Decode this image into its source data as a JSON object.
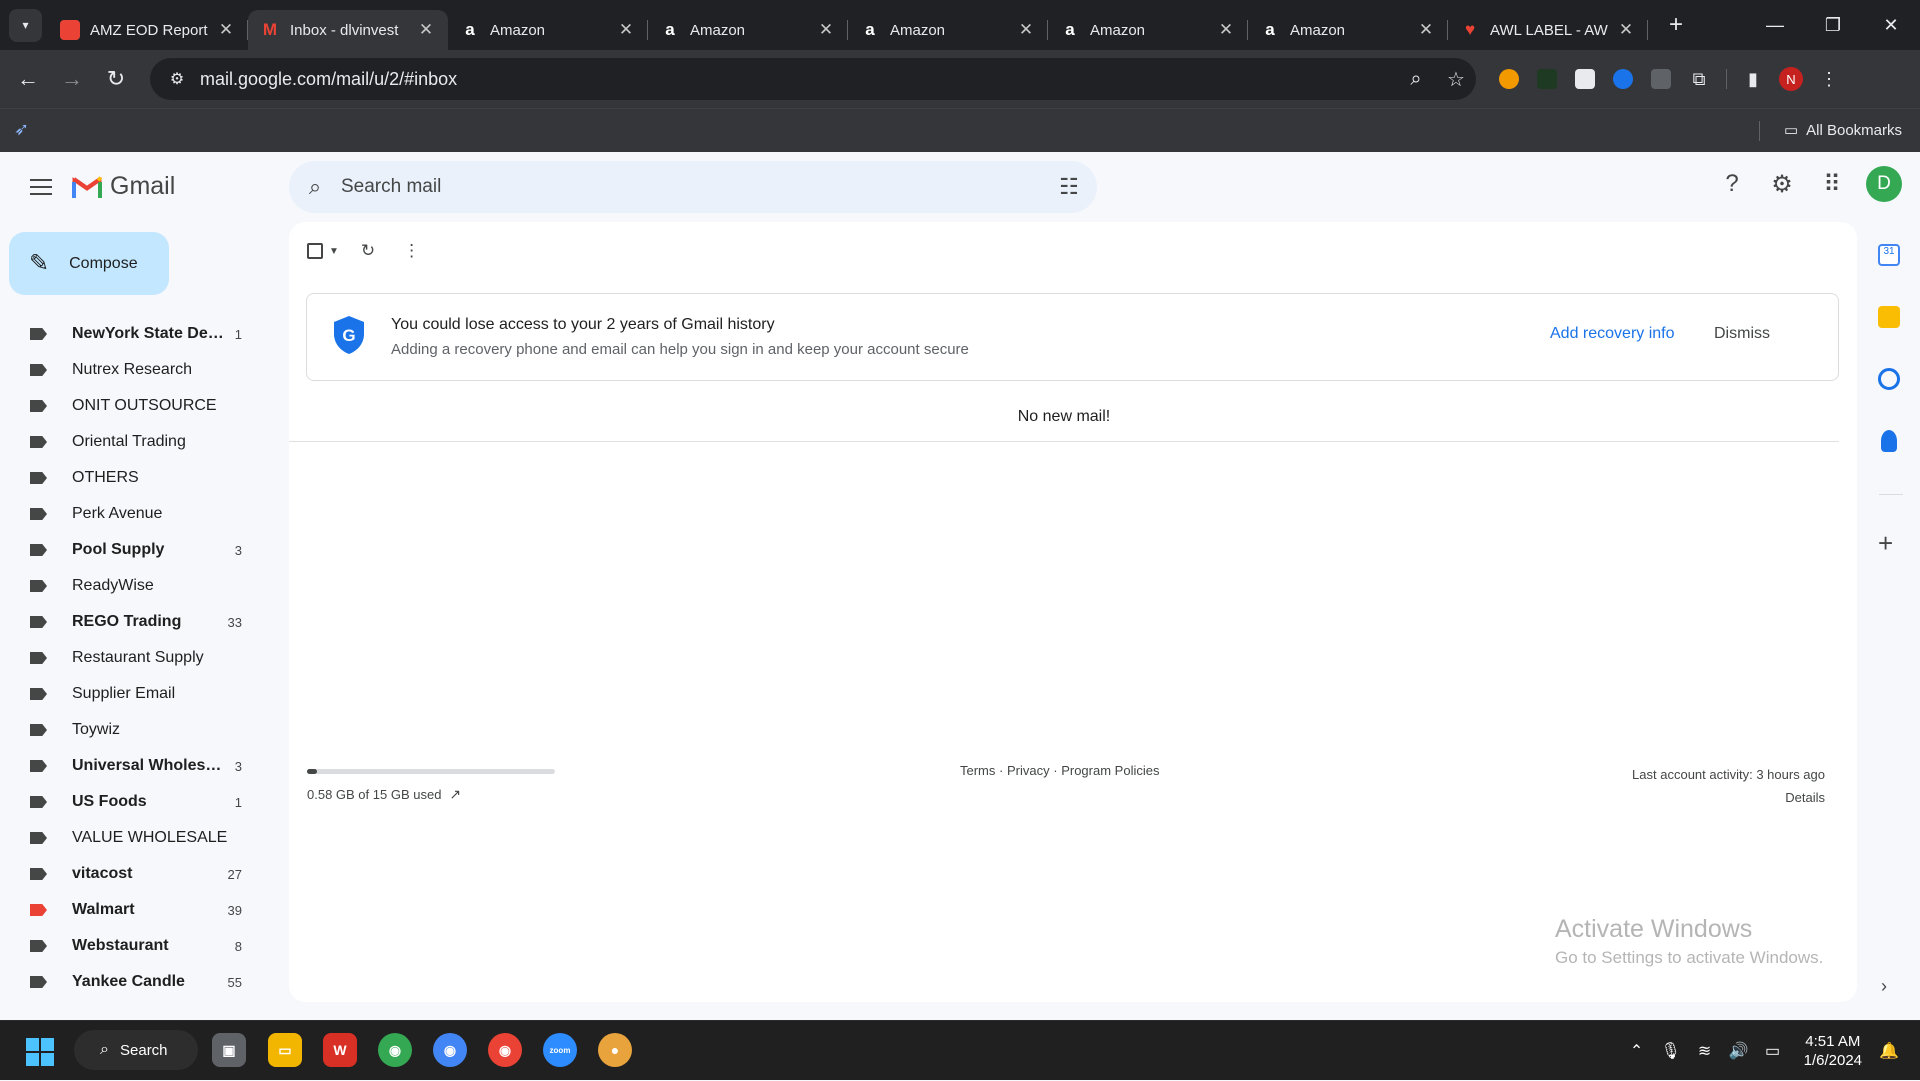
{
  "browser": {
    "tabs": [
      {
        "title": "AMZ EOD Report",
        "favicon": "red-white-app-icon",
        "active": false
      },
      {
        "title": "Inbox - dlvinvest",
        "favicon": "gmail-icon",
        "active": true
      },
      {
        "title": "Amazon",
        "favicon": "amazon-icon",
        "active": false
      },
      {
        "title": "Amazon",
        "favicon": "amazon-icon",
        "active": false
      },
      {
        "title": "Amazon",
        "favicon": "amazon-icon",
        "active": false
      },
      {
        "title": "Amazon",
        "favicon": "amazon-icon",
        "active": false
      },
      {
        "title": "Amazon",
        "favicon": "amazon-icon",
        "active": false
      },
      {
        "title": "AWL LABEL - AW",
        "favicon": "red-logo-icon",
        "active": false
      }
    ],
    "url": "mail.google.com/mail/u/2/#inbox",
    "profile_initial": "N",
    "bookmarks_label": "All Bookmarks"
  },
  "gmail": {
    "product_name": "Gmail",
    "search_placeholder": "Search mail",
    "avatar_initial": "D",
    "compose_label": "Compose",
    "labels": [
      {
        "name": "NewYork State Dep...",
        "count": "1",
        "bold": true,
        "color": "#444746"
      },
      {
        "name": "Nutrex Research",
        "count": "",
        "bold": false,
        "color": "#444746"
      },
      {
        "name": "ONIT OUTSOURCE",
        "count": "",
        "bold": false,
        "color": "#444746"
      },
      {
        "name": "Oriental Trading",
        "count": "",
        "bold": false,
        "color": "#444746"
      },
      {
        "name": "OTHERS",
        "count": "",
        "bold": false,
        "color": "#444746"
      },
      {
        "name": "Perk Avenue",
        "count": "",
        "bold": false,
        "color": "#444746"
      },
      {
        "name": "Pool Supply",
        "count": "3",
        "bold": true,
        "color": "#444746"
      },
      {
        "name": "ReadyWise",
        "count": "",
        "bold": false,
        "color": "#444746"
      },
      {
        "name": "REGO Trading",
        "count": "33",
        "bold": true,
        "color": "#444746"
      },
      {
        "name": "Restaurant Supply",
        "count": "",
        "bold": false,
        "color": "#444746"
      },
      {
        "name": "Supplier Email",
        "count": "",
        "bold": false,
        "color": "#444746"
      },
      {
        "name": "Toywiz",
        "count": "",
        "bold": false,
        "color": "#444746"
      },
      {
        "name": "Universal Wholesal...",
        "count": "3",
        "bold": true,
        "color": "#444746"
      },
      {
        "name": "US Foods",
        "count": "1",
        "bold": true,
        "color": "#444746"
      },
      {
        "name": "VALUE WHOLESALE",
        "count": "",
        "bold": false,
        "color": "#444746"
      },
      {
        "name": "vitacost",
        "count": "27",
        "bold": true,
        "color": "#444746"
      },
      {
        "name": "Walmart",
        "count": "39",
        "bold": true,
        "color": "#ea4335"
      },
      {
        "name": "Webstaurant",
        "count": "8",
        "bold": true,
        "color": "#444746"
      },
      {
        "name": "Yankee Candle",
        "count": "55",
        "bold": true,
        "color": "#444746"
      }
    ],
    "recovery": {
      "title": "You could lose access to your 2 years of Gmail history",
      "subtitle": "Adding a recovery phone and email can help you sign in and keep your account secure",
      "add_label": "Add recovery info",
      "dismiss_label": "Dismiss"
    },
    "empty_message": "No new mail!",
    "storage": {
      "text": "0.58 GB of 15 GB used",
      "fraction": 0.039
    },
    "footer": {
      "terms": "Terms",
      "privacy": "Privacy",
      "policies": "Program Policies",
      "sep": "·"
    },
    "activity": {
      "text": "Last account activity: 3 hours ago",
      "details": "Details"
    }
  },
  "watermark": {
    "line1": "Activate Windows",
    "line2": "Go to Settings to activate Windows."
  },
  "taskbar": {
    "search_label": "Search",
    "time": "4:51 AM",
    "date": "1/6/2024"
  }
}
